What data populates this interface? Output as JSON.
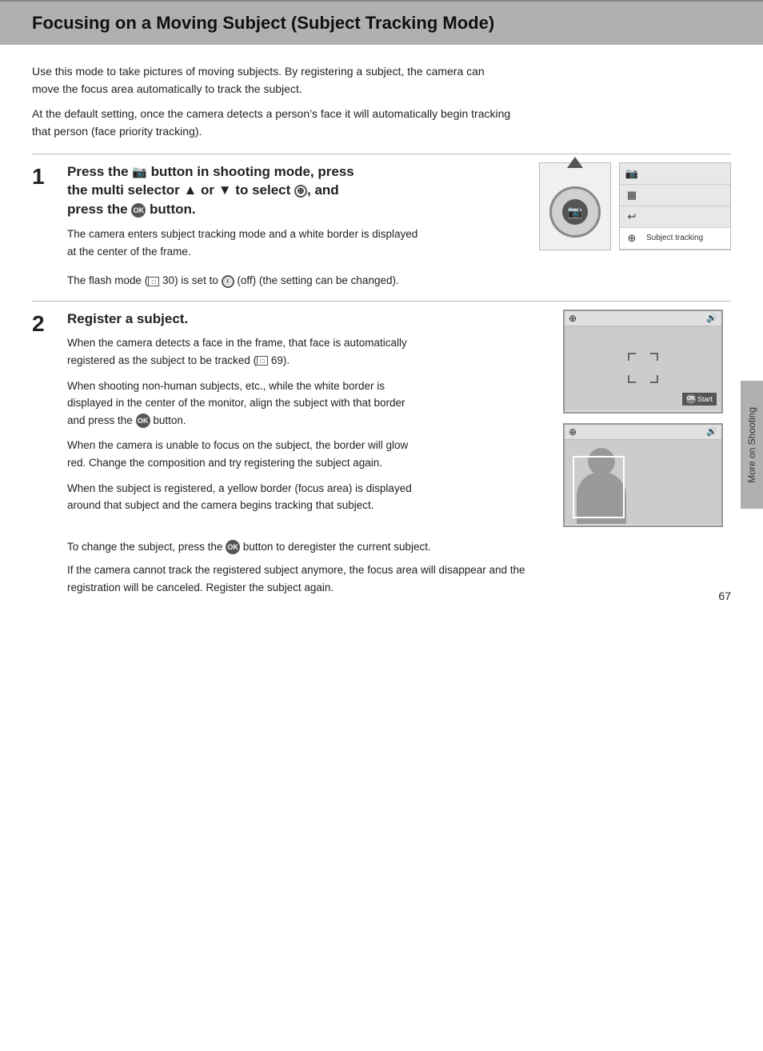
{
  "page": {
    "title": "Focusing on a Moving Subject (Subject Tracking Mode)",
    "intro": [
      "Use this mode to take pictures of moving subjects. By registering a subject, the camera can move the focus area automatically to track the subject.",
      "At the default setting, once the camera detects a person’s face it will automatically begin tracking that person (face priority tracking)."
    ],
    "steps": [
      {
        "number": "1",
        "title_parts": [
          "Press the",
          "📷",
          "button in shooting mode, press the multi selector ▲ or ▼ to select",
          "⊕",
          ", and press the",
          "OK",
          "button."
        ],
        "title_text": "Press the 📷 button in shooting mode, press the multi selector ▲ or ▼ to select ⊕, and press the ⓞ button.",
        "body": [
          "The camera enters subject tracking mode and a white border is displayed at the center of the frame.",
          "The flash mode (□ 30) is set to Ⓧ (off) (the setting can be changed)."
        ],
        "menu_items": [
          {
            "icon": "📷",
            "label": ""
          },
          {
            "icon": "▦",
            "label": ""
          },
          {
            "icon": "↩",
            "label": ""
          },
          {
            "icon": "⊕",
            "label": "Subject tracking"
          }
        ]
      },
      {
        "number": "2",
        "title_text": "Register a subject.",
        "body": [
          "When the camera detects a face in the frame, that face is automatically registered as the subject to be tracked (□ 69).",
          "When shooting non-human subjects, etc., while the white border is displayed in the center of the monitor, align the subject with that border and press the ⓞ button.",
          "When the camera is unable to focus on the subject, the border will glow red. Change the composition and try registering the subject again.",
          "When the subject is registered, a yellow border (focus area) is displayed around that subject and the camera begins tracking that subject."
        ],
        "bottom_notes": [
          "To change the subject, press the ⓞ button to deregister the current subject.",
          "If the camera cannot track the registered subject anymore, the focus area will disappear and the registration will be canceled. Register the subject again."
        ]
      }
    ],
    "side_tab_text": "More on Shooting",
    "page_number": "67"
  }
}
